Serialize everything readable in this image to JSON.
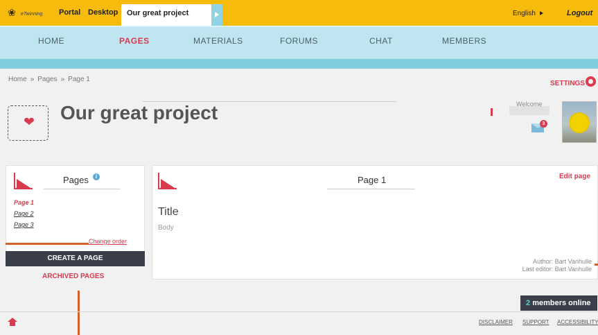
{
  "topbar": {
    "logo_text": "eTwinning",
    "links": [
      "Portal",
      "Desktop"
    ],
    "active_tab": "Our great project",
    "language": "English",
    "logout": "Logout"
  },
  "nav": {
    "items": [
      "HOME",
      "PAGES",
      "MATERIALS",
      "FORUMS",
      "CHAT",
      "MEMBERS"
    ],
    "active": "PAGES"
  },
  "breadcrumb": [
    "Home",
    "Pages",
    "Page 1"
  ],
  "breadcrumb_separator": "»",
  "settings_label": "SETTINGS",
  "project": {
    "title": "Our great project",
    "icon": "heart-icon"
  },
  "user": {
    "welcome": "Welcome",
    "unread_messages": "3"
  },
  "pages_panel": {
    "heading": "Pages",
    "info_glyph": "i",
    "pages": [
      "Page 1",
      "Page 2",
      "Page 3"
    ],
    "active_page": "Page 1",
    "change_order": "Change order",
    "create_button": "CREATE A PAGE",
    "archived": "ARCHIVED PAGES"
  },
  "page": {
    "heading": "Page 1",
    "edit_label": "Edit page",
    "title": "Title",
    "body": "Body",
    "author": "Author: Bart Vanhulle",
    "last_editor": "Last editor: Bart Vanhulle"
  },
  "footer": {
    "online_count": "2",
    "online_suffix": "members online",
    "links": [
      "DISCLAIMER",
      "SUPPORT",
      "ACCESSIBILITY"
    ]
  },
  "colors": {
    "topbar": "#f6bb0c",
    "nav": "#bfe6f0",
    "accent": "#d83b4f",
    "dark_button": "#3b3f4c",
    "annotation_orange": "#d0612a"
  }
}
